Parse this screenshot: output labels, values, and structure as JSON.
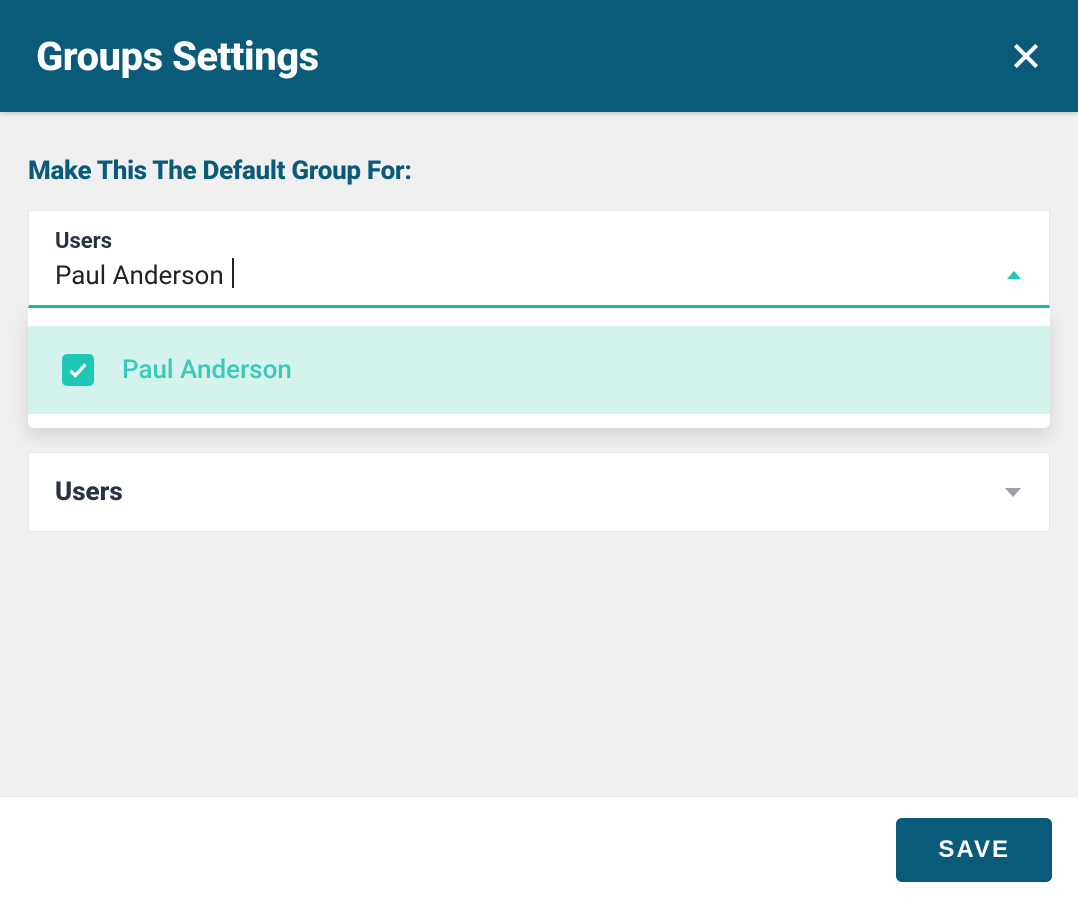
{
  "header": {
    "title": "Groups Settings"
  },
  "section": {
    "label": "Make This The Default Group For:"
  },
  "users_select": {
    "label": "Users",
    "value": "Paul Anderson",
    "options": [
      {
        "label": "Paul Anderson",
        "checked": true
      }
    ]
  },
  "secondary_select": {
    "label": "Users"
  },
  "footer": {
    "save_label": "SAVE"
  },
  "colors": {
    "brand": "#0a5a7a",
    "accent": "#1fc7b6",
    "accent_light": "#d4f3ed"
  }
}
